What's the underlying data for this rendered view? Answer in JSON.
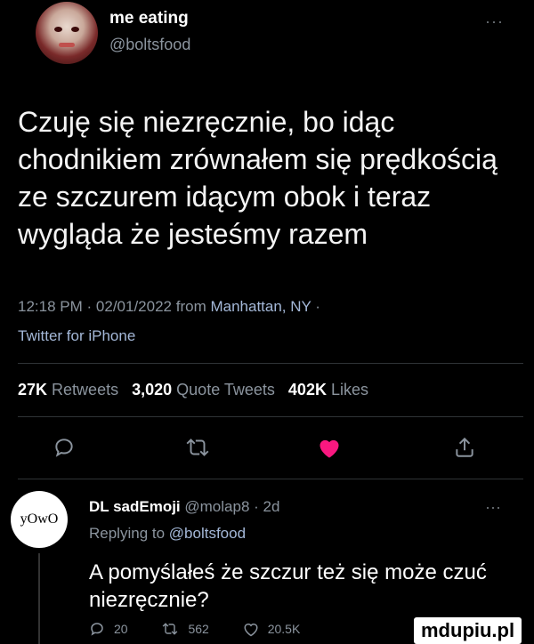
{
  "tweet": {
    "display_name": "me eating",
    "handle": "@boltsfood",
    "text": "Czuję się niezręcznie, bo idąc chodnikiem zrównałem się prędkością ze szczurem idącym obok i teraz wygląda że jesteśmy razem",
    "time": "12:18 PM",
    "date": "02/01/2022",
    "from_label": "from",
    "location": "Manhattan, NY",
    "source": "Twitter for iPhone",
    "sep": "·"
  },
  "stats": {
    "retweets_count": "27K",
    "retweets_label": "Retweets",
    "quotes_count": "3,020",
    "quotes_label": "Quote Tweets",
    "likes_count": "402K",
    "likes_label": "Likes"
  },
  "actions": {
    "icons": [
      "reply-icon",
      "retweet-icon",
      "like-icon",
      "share-icon"
    ],
    "like_color": "#f91880"
  },
  "reply": {
    "avatar_text": "yOwO",
    "display_name": "DL sadEmoji",
    "handle": "@molap8",
    "sep": "·",
    "age": "2d",
    "replying_label": "Replying to",
    "replying_handle": "@boltsfood",
    "text": "A pomyślałeś że szczur też się może czuć niezręcznie?",
    "reply_count": "20",
    "retweet_count": "562",
    "like_count": "20.5K"
  },
  "more_glyph": "···",
  "watermark": "mdupiu.pl"
}
